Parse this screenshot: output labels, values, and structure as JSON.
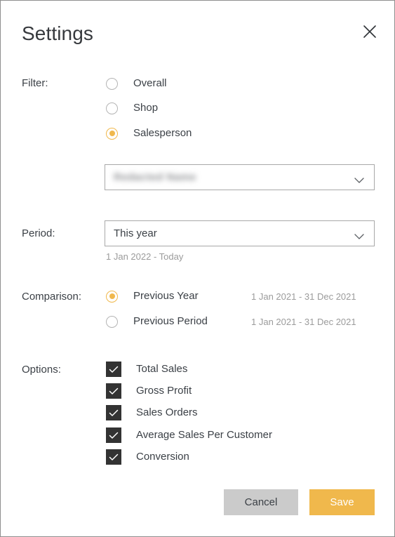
{
  "dialog": {
    "title": "Settings",
    "close_icon": "close-icon"
  },
  "filter": {
    "label": "Filter:",
    "options": [
      {
        "label": "Overall",
        "selected": false
      },
      {
        "label": "Shop",
        "selected": false
      },
      {
        "label": "Salesperson",
        "selected": true
      }
    ],
    "salesperson_select": {
      "value": "Redacted Name",
      "redacted": true,
      "chevron_icon": "chevron-down-icon"
    }
  },
  "period": {
    "label": "Period:",
    "value": "This year",
    "range": "1 Jan 2022 - Today",
    "chevron_icon": "chevron-down-icon"
  },
  "comparison": {
    "label": "Comparison:",
    "options": [
      {
        "label": "Previous Year",
        "range": "1 Jan 2021 - 31 Dec 2021",
        "selected": true
      },
      {
        "label": "Previous Period",
        "range": "1 Jan 2021 - 31 Dec 2021",
        "selected": false
      }
    ]
  },
  "options": {
    "label": "Options:",
    "items": [
      {
        "label": "Total Sales",
        "checked": true
      },
      {
        "label": "Gross Profit",
        "checked": true
      },
      {
        "label": "Sales Orders",
        "checked": true
      },
      {
        "label": "Average Sales Per Customer",
        "checked": true
      },
      {
        "label": "Conversion",
        "checked": true
      }
    ]
  },
  "footer": {
    "cancel_label": "Cancel",
    "save_label": "Save"
  },
  "colors": {
    "accent": "#f0b84c",
    "checkbox_fill": "#333333",
    "cancel_bg": "#cbcbcb",
    "text": "#3b4046",
    "muted_text": "#9b9b9b",
    "border": "#a8a8a8"
  }
}
